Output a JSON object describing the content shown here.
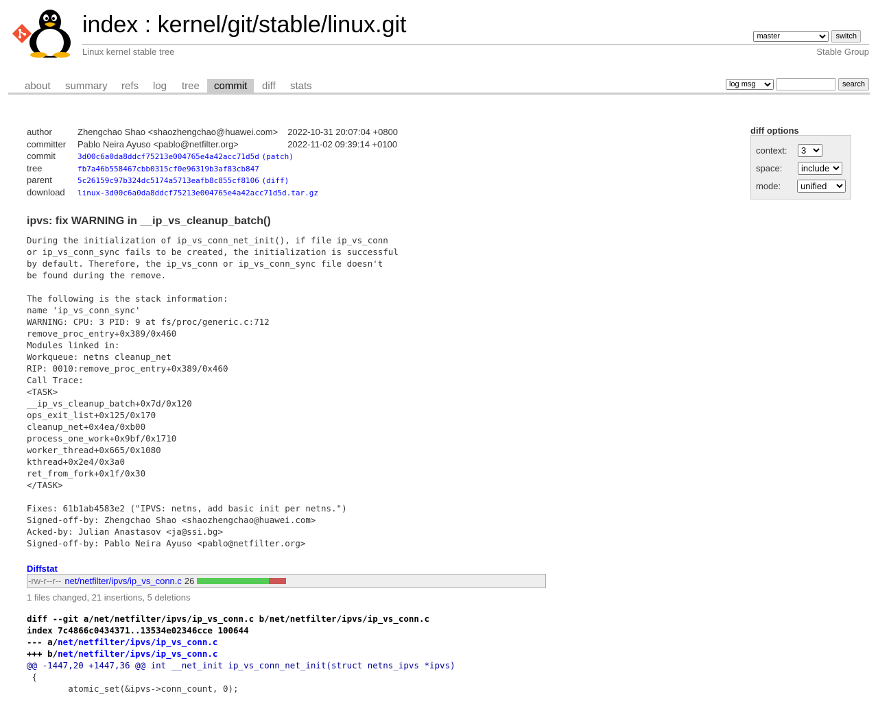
{
  "header": {
    "title_index": "index",
    "title_sep": " : ",
    "title_repo": "kernel/git/stable/linux.git",
    "subtitle": "Linux kernel stable tree",
    "owner": "Stable Group",
    "branch_selected": "master",
    "switch_label": "switch"
  },
  "tabs": [
    {
      "label": "about"
    },
    {
      "label": "summary"
    },
    {
      "label": "refs"
    },
    {
      "label": "log"
    },
    {
      "label": "tree"
    },
    {
      "label": "commit"
    },
    {
      "label": "diff"
    },
    {
      "label": "stats"
    }
  ],
  "active_tab": "commit",
  "search": {
    "scope_selected": "log msg",
    "query": "",
    "button_label": "search"
  },
  "commit_info": {
    "author_label": "author",
    "author": "Zhengchao Shao <shaozhengchao@huawei.com>",
    "author_date": "2022-10-31 20:07:04 +0800",
    "committer_label": "committer",
    "committer": "Pablo Neira Ayuso <pablo@netfilter.org>",
    "committer_date": "2022-11-02 09:39:14 +0100",
    "commit_label": "commit",
    "commit_sha": "3d00c6a0da8ddcf75213e004765e4a42acc71d5d",
    "patch_link": "(patch)",
    "tree_label": "tree",
    "tree_sha": "fb7a46b558467cbb0315cf0e96319b3af83cb847",
    "parent_label": "parent",
    "parent_sha": "5c26159c97b324dc5174a5713eafb8c855cf8106",
    "diff_link": "(diff)",
    "download_label": "download",
    "download_file": "linux-3d00c6a0da8ddcf75213e004765e4a42acc71d5d.tar.gz"
  },
  "diff_options": {
    "title": "diff options",
    "context_label": "context:",
    "context_value": "3",
    "space_label": "space:",
    "space_value": "include",
    "mode_label": "mode:",
    "mode_value": "unified"
  },
  "commit_subject": "ipvs: fix WARNING in __ip_vs_cleanup_batch()",
  "commit_message": "During the initialization of ip_vs_conn_net_init(), if file ip_vs_conn\nor ip_vs_conn_sync fails to be created, the initialization is successful\nby default. Therefore, the ip_vs_conn or ip_vs_conn_sync file doesn't\nbe found during the remove.\n\nThe following is the stack information:\nname 'ip_vs_conn_sync'\nWARNING: CPU: 3 PID: 9 at fs/proc/generic.c:712\nremove_proc_entry+0x389/0x460\nModules linked in:\nWorkqueue: netns cleanup_net\nRIP: 0010:remove_proc_entry+0x389/0x460\nCall Trace:\n<TASK>\n__ip_vs_cleanup_batch+0x7d/0x120\nops_exit_list+0x125/0x170\ncleanup_net+0x4ea/0xb00\nprocess_one_work+0x9bf/0x1710\nworker_thread+0x665/0x1080\nkthread+0x2e4/0x3a0\nret_from_fork+0x1f/0x30\n</TASK>\n\nFixes: 61b1ab4583e2 (\"IPVS: netns, add basic init per netns.\")\nSigned-off-by: Zhengchao Shao <shaozhengchao@huawei.com>\nAcked-by: Julian Anastasov <ja@ssi.bg>\nSigned-off-by: Pablo Neira Ayuso <pablo@netfilter.org>",
  "diffstat": {
    "header": "Diffstat",
    "mode": "-rw-r--r--",
    "file": "net/netfilter/ipvs/ip_vs_conn.c",
    "count": "26",
    "insertions": 21,
    "deletions": 5,
    "summary": "1 files changed, 21 insertions, 5 deletions"
  },
  "diff": {
    "git_line": "diff --git a/net/netfilter/ipvs/ip_vs_conn.c b/net/netfilter/ipvs/ip_vs_conn.c",
    "index_line": "index 7c4866c0434371..13534e02346cce 100644",
    "minus_prefix": "--- a/",
    "minus_path": "net/netfilter/ipvs/ip_vs_conn.c",
    "plus_prefix": "+++ b/",
    "plus_path": "net/netfilter/ipvs/ip_vs_conn.c",
    "hunk": "@@ -1447,20 +1447,36 @@ int __net_init ip_vs_conn_net_init(struct netns_ipvs *ipvs)",
    "context_lines": [
      " {",
      "\tatomic_set(&ipvs->conn_count, 0);"
    ]
  }
}
